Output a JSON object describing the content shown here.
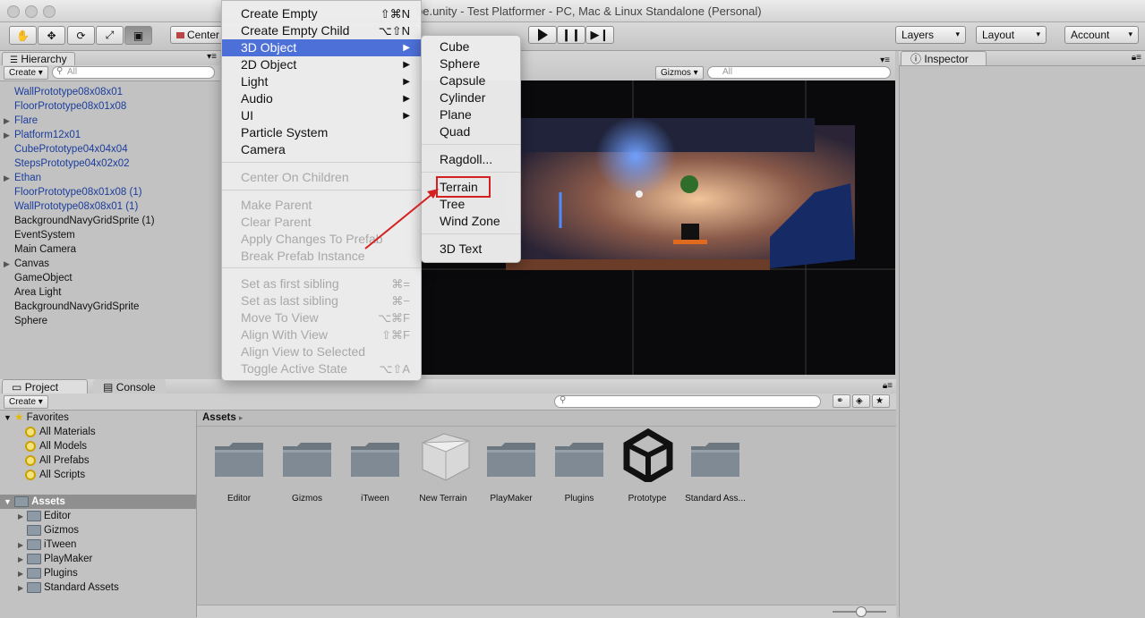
{
  "window": {
    "title": "be.unity - Test Platformer - PC, Mac & Linux Standalone (Personal)"
  },
  "toolbar": {
    "center_label": "Center",
    "layers_label": "Layers",
    "layout_label": "Layout",
    "account_label": "Account"
  },
  "hierarchy": {
    "tab": "Hierarchy",
    "create": "Create",
    "search_placeholder": "All",
    "items": [
      {
        "label": "WallPrototype08x08x01",
        "prefab": true,
        "expandable": false
      },
      {
        "label": "FloorPrototype08x01x08",
        "prefab": true,
        "expandable": false
      },
      {
        "label": "Flare",
        "prefab": true,
        "expandable": true
      },
      {
        "label": "Platform12x01",
        "prefab": true,
        "expandable": true
      },
      {
        "label": "CubePrototype04x04x04",
        "prefab": true,
        "expandable": false
      },
      {
        "label": "StepsPrototype04x02x02",
        "prefab": true,
        "expandable": false
      },
      {
        "label": "Ethan",
        "prefab": true,
        "expandable": true
      },
      {
        "label": "FloorPrototype08x01x08 (1)",
        "prefab": true,
        "expandable": false
      },
      {
        "label": "WallPrototype08x08x01 (1)",
        "prefab": true,
        "expandable": false
      },
      {
        "label": "BackgroundNavyGridSprite (1)",
        "prefab": false,
        "expandable": false
      },
      {
        "label": "EventSystem",
        "prefab": false,
        "expandable": false
      },
      {
        "label": "Main Camera",
        "prefab": false,
        "expandable": false
      },
      {
        "label": "Canvas",
        "prefab": false,
        "expandable": true
      },
      {
        "label": "GameObject",
        "prefab": false,
        "expandable": false
      },
      {
        "label": "Area Light",
        "prefab": false,
        "expandable": false
      },
      {
        "label": "BackgroundNavyGridSprite",
        "prefab": false,
        "expandable": false
      },
      {
        "label": "Sphere",
        "prefab": false,
        "expandable": false
      }
    ]
  },
  "scene": {
    "gizmos_label": "Gizmos",
    "search_placeholder": "All"
  },
  "inspector": {
    "tab": "Inspector"
  },
  "gameobject_menu": {
    "items": [
      {
        "label": "Create Empty",
        "shortcut": "⇧⌘N",
        "disabled": false,
        "submenu": false,
        "highlighted": false
      },
      {
        "label": "Create Empty Child",
        "shortcut": "⌥⇧N",
        "disabled": false,
        "submenu": false,
        "highlighted": false
      },
      {
        "label": "3D Object",
        "shortcut": "",
        "disabled": false,
        "submenu": true,
        "highlighted": true
      },
      {
        "label": "2D Object",
        "shortcut": "",
        "disabled": false,
        "submenu": true,
        "highlighted": false
      },
      {
        "label": "Light",
        "shortcut": "",
        "disabled": false,
        "submenu": true,
        "highlighted": false
      },
      {
        "label": "Audio",
        "shortcut": "",
        "disabled": false,
        "submenu": true,
        "highlighted": false
      },
      {
        "label": "UI",
        "shortcut": "",
        "disabled": false,
        "submenu": true,
        "highlighted": false
      },
      {
        "label": "Particle System",
        "shortcut": "",
        "disabled": false,
        "submenu": false,
        "highlighted": false
      },
      {
        "label": "Camera",
        "shortcut": "",
        "disabled": false,
        "submenu": false,
        "highlighted": false
      },
      {
        "label": "Center On Children",
        "shortcut": "",
        "disabled": true,
        "submenu": false,
        "highlighted": false
      },
      {
        "label": "Make Parent",
        "shortcut": "",
        "disabled": true,
        "submenu": false,
        "highlighted": false
      },
      {
        "label": "Clear Parent",
        "shortcut": "",
        "disabled": true,
        "submenu": false,
        "highlighted": false
      },
      {
        "label": "Apply Changes To Prefab",
        "shortcut": "",
        "disabled": true,
        "submenu": false,
        "highlighted": false
      },
      {
        "label": "Break Prefab Instance",
        "shortcut": "",
        "disabled": true,
        "submenu": false,
        "highlighted": false
      },
      {
        "label": "Set as first sibling",
        "shortcut": "⌘=",
        "disabled": true,
        "submenu": false,
        "highlighted": false
      },
      {
        "label": "Set as last sibling",
        "shortcut": "⌘−",
        "disabled": true,
        "submenu": false,
        "highlighted": false
      },
      {
        "label": "Move To View",
        "shortcut": "⌥⌘F",
        "disabled": true,
        "submenu": false,
        "highlighted": false
      },
      {
        "label": "Align With View",
        "shortcut": "⇧⌘F",
        "disabled": true,
        "submenu": false,
        "highlighted": false
      },
      {
        "label": "Align View to Selected",
        "shortcut": "",
        "disabled": true,
        "submenu": false,
        "highlighted": false
      },
      {
        "label": "Toggle Active State",
        "shortcut": "⌥⇧A",
        "disabled": true,
        "submenu": false,
        "highlighted": false
      }
    ]
  },
  "object3d_submenu": {
    "items": [
      "Cube",
      "Sphere",
      "Capsule",
      "Cylinder",
      "Plane",
      "Quad",
      "Ragdoll...",
      "Terrain",
      "Tree",
      "Wind Zone",
      "3D Text"
    ],
    "annotated_item": "Terrain"
  },
  "project": {
    "tab": "Project",
    "console_tab": "Console",
    "create": "Create",
    "favorites_label": "Favorites",
    "favorites": [
      "All Materials",
      "All Models",
      "All Prefabs",
      "All Scripts"
    ],
    "assets_label": "Assets",
    "asset_tree": [
      {
        "label": "Editor",
        "expandable": true
      },
      {
        "label": "Gizmos",
        "expandable": false
      },
      {
        "label": "iTween",
        "expandable": true
      },
      {
        "label": "PlayMaker",
        "expandable": true
      },
      {
        "label": "Plugins",
        "expandable": true
      },
      {
        "label": "Standard Assets",
        "expandable": true
      }
    ],
    "breadcrumb": "Assets",
    "grid": [
      {
        "label": "Editor",
        "kind": "folder"
      },
      {
        "label": "Gizmos",
        "kind": "folder"
      },
      {
        "label": "iTween",
        "kind": "folder"
      },
      {
        "label": "New Terrain",
        "kind": "terrain"
      },
      {
        "label": "PlayMaker",
        "kind": "folder"
      },
      {
        "label": "Plugins",
        "kind": "folder"
      },
      {
        "label": "Prototype",
        "kind": "unity"
      },
      {
        "label": "Standard Ass...",
        "kind": "folder"
      }
    ]
  },
  "colors": {
    "menu_highlight": "#4d6fd8",
    "prefab_text": "#1b3d9c",
    "annotation_red": "#d42020"
  }
}
